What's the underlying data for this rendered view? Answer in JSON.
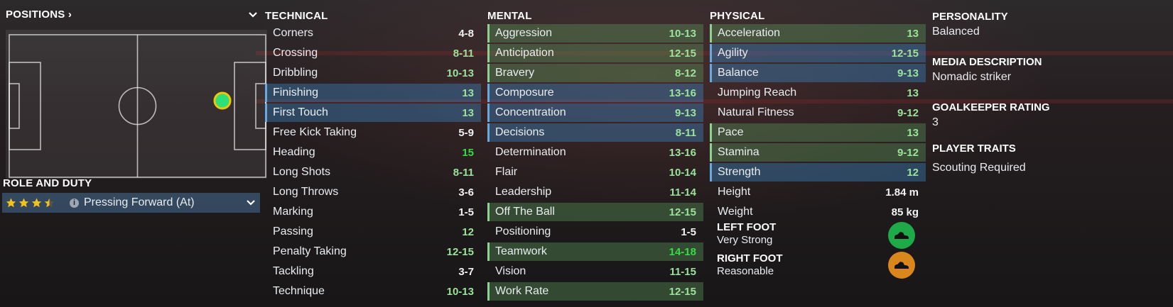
{
  "positions": {
    "title": "POSITIONS ›",
    "chevron_icon": "chevron-down-icon"
  },
  "role": {
    "title": "ROLE AND DUTY",
    "stars": 3.5,
    "name": "Pressing Forward (At)",
    "info_icon": "info-icon",
    "chevron_icon": "chevron-down-icon"
  },
  "technical": {
    "title": "TECHNICAL",
    "rows": [
      {
        "name": "Corners",
        "val": "4-8",
        "style": "",
        "color": "w"
      },
      {
        "name": "Crossing",
        "val": "8-11",
        "style": "",
        "color": "g"
      },
      {
        "name": "Dribbling",
        "val": "10-13",
        "style": "",
        "color": "g"
      },
      {
        "name": "Finishing",
        "val": "13",
        "style": "key",
        "color": "g"
      },
      {
        "name": "First Touch",
        "val": "13",
        "style": "key",
        "color": "g"
      },
      {
        "name": "Free Kick Taking",
        "val": "5-9",
        "style": "",
        "color": "w"
      },
      {
        "name": "Heading",
        "val": "15",
        "style": "",
        "color": "b"
      },
      {
        "name": "Long Shots",
        "val": "8-11",
        "style": "",
        "color": "g"
      },
      {
        "name": "Long Throws",
        "val": "3-6",
        "style": "",
        "color": "w"
      },
      {
        "name": "Marking",
        "val": "1-5",
        "style": "",
        "color": "w"
      },
      {
        "name": "Passing",
        "val": "12",
        "style": "",
        "color": "g"
      },
      {
        "name": "Penalty Taking",
        "val": "12-15",
        "style": "",
        "color": "g"
      },
      {
        "name": "Tackling",
        "val": "3-7",
        "style": "",
        "color": "w"
      },
      {
        "name": "Technique",
        "val": "10-13",
        "style": "",
        "color": "g"
      }
    ]
  },
  "mental": {
    "title": "MENTAL",
    "rows": [
      {
        "name": "Aggression",
        "val": "10-13",
        "style": "pref",
        "color": "g"
      },
      {
        "name": "Anticipation",
        "val": "12-15",
        "style": "pref",
        "color": "g"
      },
      {
        "name": "Bravery",
        "val": "8-12",
        "style": "pref",
        "color": "g"
      },
      {
        "name": "Composure",
        "val": "13-16",
        "style": "key",
        "color": "g"
      },
      {
        "name": "Concentration",
        "val": "9-13",
        "style": "key",
        "color": "g"
      },
      {
        "name": "Decisions",
        "val": "8-11",
        "style": "key",
        "color": "g"
      },
      {
        "name": "Determination",
        "val": "13-16",
        "style": "",
        "color": "g"
      },
      {
        "name": "Flair",
        "val": "10-14",
        "style": "",
        "color": "g"
      },
      {
        "name": "Leadership",
        "val": "11-14",
        "style": "",
        "color": "g"
      },
      {
        "name": "Off The Ball",
        "val": "12-15",
        "style": "pref",
        "color": "g"
      },
      {
        "name": "Positioning",
        "val": "1-5",
        "style": "",
        "color": "w"
      },
      {
        "name": "Teamwork",
        "val": "14-18",
        "style": "pref",
        "color": "b"
      },
      {
        "name": "Vision",
        "val": "11-15",
        "style": "",
        "color": "g"
      },
      {
        "name": "Work Rate",
        "val": "12-15",
        "style": "pref",
        "color": "g"
      }
    ]
  },
  "physical": {
    "title": "PHYSICAL",
    "rows": [
      {
        "name": "Acceleration",
        "val": "13",
        "style": "pref",
        "color": "g"
      },
      {
        "name": "Agility",
        "val": "12-15",
        "style": "key",
        "color": "g"
      },
      {
        "name": "Balance",
        "val": "9-13",
        "style": "key",
        "color": "g"
      },
      {
        "name": "Jumping Reach",
        "val": "13",
        "style": "",
        "color": "g"
      },
      {
        "name": "Natural Fitness",
        "val": "9-12",
        "style": "",
        "color": "g"
      },
      {
        "name": "Pace",
        "val": "13",
        "style": "pref",
        "color": "g"
      },
      {
        "name": "Stamina",
        "val": "9-12",
        "style": "pref",
        "color": "g"
      },
      {
        "name": "Strength",
        "val": "12",
        "style": "key",
        "color": "g"
      },
      {
        "name": "Height",
        "val": "1.84 m",
        "style": "",
        "color": "w"
      },
      {
        "name": "Weight",
        "val": "85 kg",
        "style": "",
        "color": "w"
      }
    ],
    "left_foot": {
      "label": "LEFT FOOT",
      "value": "Very Strong",
      "color": "#1faa4a",
      "icon": "boot-icon"
    },
    "right_foot": {
      "label": "RIGHT FOOT",
      "value": "Reasonable",
      "color": "#d9861c",
      "icon": "boot-icon"
    }
  },
  "info": {
    "personality_label": "PERSONALITY",
    "personality": "Balanced",
    "media_label": "MEDIA DESCRIPTION",
    "media": "Nomadic striker",
    "gk_label": "GOALKEEPER RATING",
    "gk": "3",
    "traits_label": "PLAYER TRAITS",
    "traits": "Scouting Required"
  },
  "colors": {
    "key": "#6aa8e0",
    "pref": "#8fd28f",
    "green": "#9be39b",
    "bright": "#33dd44"
  }
}
